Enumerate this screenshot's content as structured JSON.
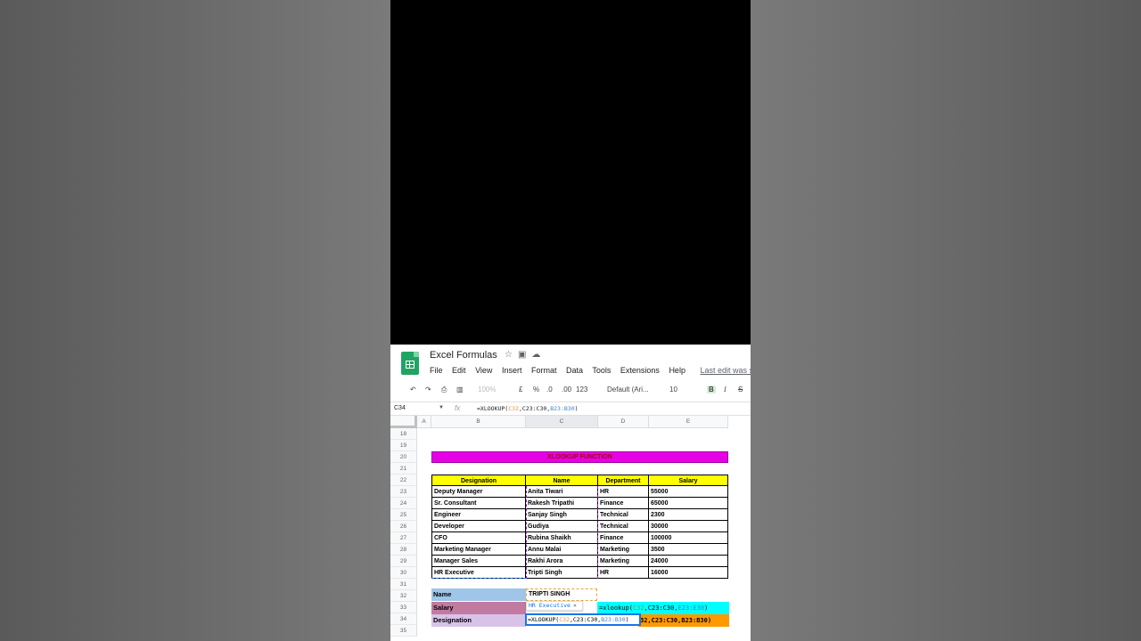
{
  "app": {
    "doc_title": "Excel Formulas",
    "title_icons": [
      "star-icon",
      "move-to-folder-icon",
      "cloud-status-icon"
    ],
    "menus": [
      "File",
      "Edit",
      "View",
      "Insert",
      "Format",
      "Data",
      "Tools",
      "Extensions",
      "Help"
    ],
    "last_edit": "Last edit was secon"
  },
  "toolbar": {
    "zoom": "100%",
    "currency": "£",
    "percent": "%",
    "dec_decrease": ".0",
    "dec_increase": ".00",
    "format_more": "123",
    "font": "Default (Ari...",
    "font_size": "10",
    "bold": "B",
    "italic": "I",
    "strike": "S"
  },
  "formula_bar": {
    "name_box": "C34",
    "fx": "fx",
    "formula_prefix": "=XLOOKUP(",
    "formula_arg1": "C32",
    "formula_mid": ",C23:C30,",
    "formula_arg3": "B23:B30",
    "formula_suffix": ")"
  },
  "columns": [
    "A",
    "B",
    "C",
    "D",
    "E"
  ],
  "rows": [
    "18",
    "19",
    "20",
    "21",
    "22",
    "23",
    "24",
    "25",
    "26",
    "27",
    "28",
    "29",
    "30",
    "31",
    "32",
    "33",
    "34",
    "35"
  ],
  "sheet": {
    "title": "XLOOKUP FUNCTION",
    "headers": [
      "Designation",
      "Name",
      "Department",
      "Salary"
    ],
    "table": [
      [
        "Deputy Manager",
        "Anita Tiwari",
        "HR",
        "55000"
      ],
      [
        "Sr. Consultant",
        "Rakesh Tripathi",
        "Finance",
        "65000"
      ],
      [
        "Engineer",
        "Sanjay Singh",
        "Technical",
        "2300"
      ],
      [
        "Developer",
        "Gudiya",
        "Technical",
        "30000"
      ],
      [
        "CFO",
        "Rubina Shaikh",
        "Finance",
        "100000"
      ],
      [
        "Marketing Manager",
        "Annu Malai",
        "Marketing",
        "3500"
      ],
      [
        "Manager Sales",
        "Rakhi Arora",
        "Marketing",
        "24000"
      ],
      [
        "HR Executive",
        "Tripti Singh",
        "HR",
        "16000"
      ]
    ],
    "lookup_labels": [
      "Name",
      "Salary",
      "Designation"
    ],
    "lookup_name_value": "TRIPTI SINGH",
    "autocomplete_hint": "HR Executive",
    "autocomplete_close": "×",
    "salary_formula": {
      "prefix": "=xlookup(",
      "arg1": "C32",
      "mid": ",C23:C30,",
      "arg3": "E23:E30",
      "suffix": ")"
    },
    "overflow_text": "32,C23:C30,B23:B30)",
    "editing_formula": {
      "prefix": "=XLOOKUP(",
      "arg1": "C32",
      "mid": ",C23:C30,",
      "arg3": "B23:B30",
      "suffix": ")"
    }
  },
  "colors": {
    "title_band": "#e600e6",
    "header_fill": "#ffff00",
    "label_name": "#9fc5e8",
    "label_salary": "#c27ba0",
    "label_designation": "#d9c2e8",
    "cyan_bar": "#00ffff",
    "orange_bar": "#ff9900"
  }
}
